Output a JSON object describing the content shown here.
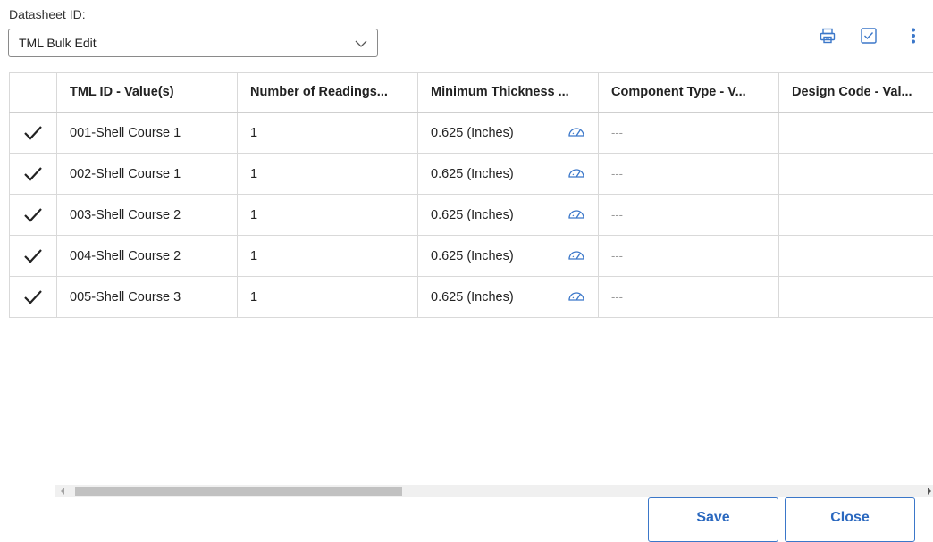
{
  "datasheet": {
    "label": "Datasheet ID:",
    "selected": "TML Bulk Edit"
  },
  "toolbar": {
    "print_icon": "printer-icon",
    "check_icon": "checkbox-icon",
    "more_icon": "vertical-ellipsis-icon"
  },
  "table": {
    "headers": [
      "",
      "TML ID - Value(s)",
      "Number of Readings...",
      "Minimum Thickness ...",
      "Component Type - V...",
      "Design Code - Val..."
    ],
    "rows": [
      {
        "checked": true,
        "tml_id": "001-Shell Course 1",
        "readings": "1",
        "min_thickness": "0.625 (Inches)",
        "component_type": "---",
        "design_code": ""
      },
      {
        "checked": true,
        "tml_id": "002-Shell Course 1",
        "readings": "1",
        "min_thickness": "0.625 (Inches)",
        "component_type": "---",
        "design_code": ""
      },
      {
        "checked": true,
        "tml_id": "003-Shell Course 2",
        "readings": "1",
        "min_thickness": "0.625 (Inches)",
        "component_type": "---",
        "design_code": ""
      },
      {
        "checked": true,
        "tml_id": "004-Shell Course 2",
        "readings": "1",
        "min_thickness": "0.625 (Inches)",
        "component_type": "---",
        "design_code": ""
      },
      {
        "checked": true,
        "tml_id": "005-Shell Course 3",
        "readings": "1",
        "min_thickness": "0.625 (Inches)",
        "component_type": "---",
        "design_code": ""
      }
    ]
  },
  "footer": {
    "save_label": "Save",
    "close_label": "Close"
  },
  "colors": {
    "accent": "#2a68bf",
    "border": "#d9d9d9",
    "icon_blue": "#3b77c9"
  }
}
